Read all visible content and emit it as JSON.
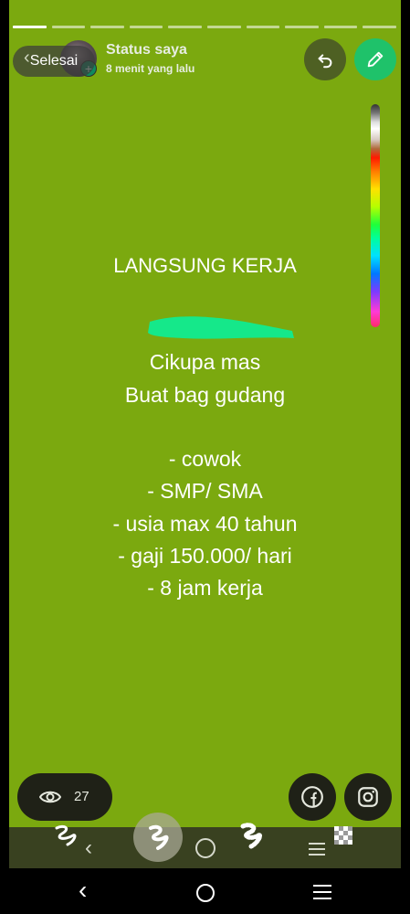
{
  "header": {
    "title": "Status saya",
    "time": "8 menit yang lalu",
    "done_label": "Selesai"
  },
  "story": {
    "background_color": "#7ba90f",
    "headline": "LANGSUNG KERJA",
    "lines": [
      "Cikupa mas",
      "Buat bag gudang",
      "- cowok",
      "- SMP/ SMA",
      "- usia max 40 tahun",
      "- gaji 150.000/ hari",
      "- 8 jam kerja"
    ]
  },
  "footer": {
    "views_count": "27"
  },
  "colors": {
    "accent": "#1fc26a",
    "pill": "#1f2117",
    "toolbar": "#394120"
  },
  "icons": {
    "undo": "undo-icon",
    "edit": "pencil-icon",
    "views": "eye-icon",
    "facebook": "facebook-icon",
    "instagram": "instagram-icon"
  }
}
